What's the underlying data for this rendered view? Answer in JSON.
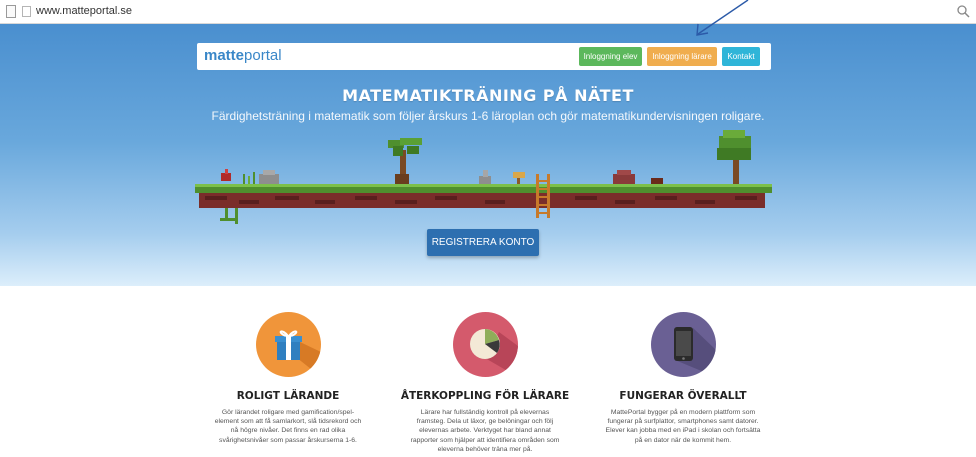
{
  "browser": {
    "url": "www.matteportal.se"
  },
  "nav": {
    "logo_part1": "matte",
    "logo_part2": "portal",
    "buttons": [
      "Inloggning elev",
      "Inloggning lärare",
      "Kontakt"
    ]
  },
  "hero": {
    "title": "MATEMATIKTRÄNING PÅ NÄTET",
    "subtitle": "Färdighetsträning i matematik som följer årskurs 1-6 läroplan och gör matematikundervisningen roligare.",
    "cta": "REGISTRERA KONTO"
  },
  "features": [
    {
      "icon": "gift-icon",
      "color": "#f0953a",
      "title": "ROLIGT LÄRANDE",
      "lines": [
        "Gör lärandet roligare med gamification/spel-",
        "element som att få samlarkort, slå tidsrekord och",
        "nå högre nivåer. Det finns en rad olika",
        "svårighetsnivåer som passar årskurserna 1-6."
      ]
    },
    {
      "icon": "pie-chart-icon",
      "color": "#d45a6c",
      "title": "ÅTERKOPPLING FÖR LÄRARE",
      "lines": [
        "Lärare har fullständig kontroll på elevernas",
        "framsteg. Dela ut läxor, ge belöningar och följ",
        "elevernas arbete. Verktyget har bland annat",
        "rapporter som hjälper att identifiera områden som",
        "eleverna behöver träna mer på."
      ]
    },
    {
      "icon": "tablet-icon",
      "color": "#6a6094",
      "title": "FUNGERAR ÖVERALLT",
      "lines": [
        "MattePortal bygger på en modern plattform som",
        "fungerar på surfplattor, smartphones samt datorer.",
        "Elever kan jobba med en iPad i skolan och fortsätta",
        "på en dator när de kommit hem."
      ]
    }
  ],
  "colors": {
    "green": "#5cb85c",
    "orange": "#f0ad4e",
    "cyan": "#2fb5d8",
    "cta": "#2d6fb0",
    "logo": "#3a87c8"
  }
}
